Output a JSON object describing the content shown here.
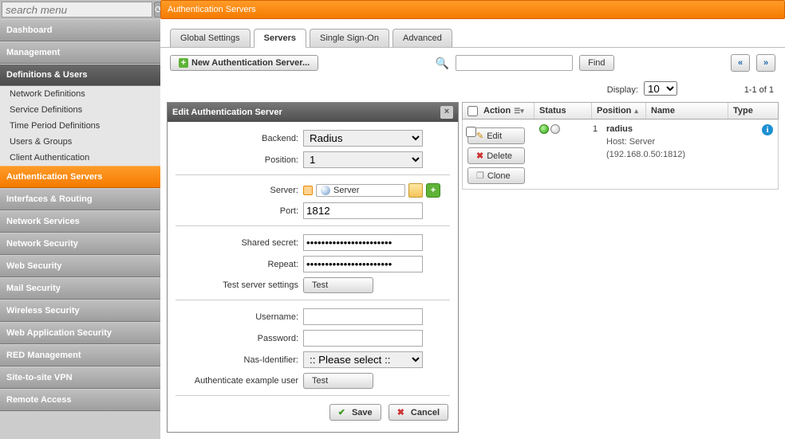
{
  "search": {
    "placeholder": "search menu"
  },
  "header": {
    "title": "Authentication Servers"
  },
  "sidebar": {
    "items": [
      {
        "label": "Dashboard",
        "cls": ""
      },
      {
        "label": "Management",
        "cls": ""
      },
      {
        "label": "Definitions & Users",
        "cls": "dark"
      },
      {
        "label": "Network Definitions",
        "cls": "sub"
      },
      {
        "label": "Service Definitions",
        "cls": "sub"
      },
      {
        "label": "Time Period Definitions",
        "cls": "sub"
      },
      {
        "label": "Users & Groups",
        "cls": "sub"
      },
      {
        "label": "Client Authentication",
        "cls": "sub"
      },
      {
        "label": "Authentication Servers",
        "cls": "active"
      },
      {
        "label": "Interfaces & Routing",
        "cls": ""
      },
      {
        "label": "Network Services",
        "cls": ""
      },
      {
        "label": "Network Security",
        "cls": ""
      },
      {
        "label": "Web Security",
        "cls": ""
      },
      {
        "label": "Mail Security",
        "cls": ""
      },
      {
        "label": "Wireless Security",
        "cls": ""
      },
      {
        "label": "Web Application Security",
        "cls": ""
      },
      {
        "label": "RED Management",
        "cls": ""
      },
      {
        "label": "Site-to-site VPN",
        "cls": ""
      },
      {
        "label": "Remote Access",
        "cls": ""
      }
    ]
  },
  "tabs": [
    "Global Settings",
    "Servers",
    "Single Sign-On",
    "Advanced"
  ],
  "activeTab": 1,
  "toolbar": {
    "new_label": "New Authentication Server...",
    "find_label": "Find"
  },
  "display": {
    "label": "Display:",
    "options": [
      "10"
    ],
    "value": "10",
    "count": "1-1 of 1"
  },
  "edit": {
    "title": "Edit Authentication Server",
    "rows": {
      "backend_label": "Backend:",
      "backend_value": "Radius",
      "position_label": "Position:",
      "position_value": "1",
      "server_label": "Server:",
      "server_obj": "Server",
      "port_label": "Port:",
      "port_value": "1812",
      "secret_label": "Shared secret:",
      "repeat_label": "Repeat:",
      "secret_value": "•••••••••••••••••••••••",
      "testserver_label": "Test server settings",
      "username_label": "Username:",
      "username_value": "",
      "password_label": "Password:",
      "password_value": "",
      "nas_label": "Nas-Identifier:",
      "nas_value": ":: Please select ::",
      "authex_label": "Authenticate example user",
      "test_btn": "Test",
      "save_btn": "Save",
      "cancel_btn": "Cancel"
    }
  },
  "list": {
    "headers": {
      "action": "Action",
      "status": "Status",
      "position": "Position",
      "name": "Name",
      "type": "Type"
    },
    "actions": {
      "edit": "Edit",
      "delete": "Delete",
      "clone": "Clone"
    },
    "rows": [
      {
        "pos": "1",
        "name": "radius",
        "sub1": "Host: Server",
        "sub2": "(192.168.0.50:1812)"
      }
    ]
  }
}
